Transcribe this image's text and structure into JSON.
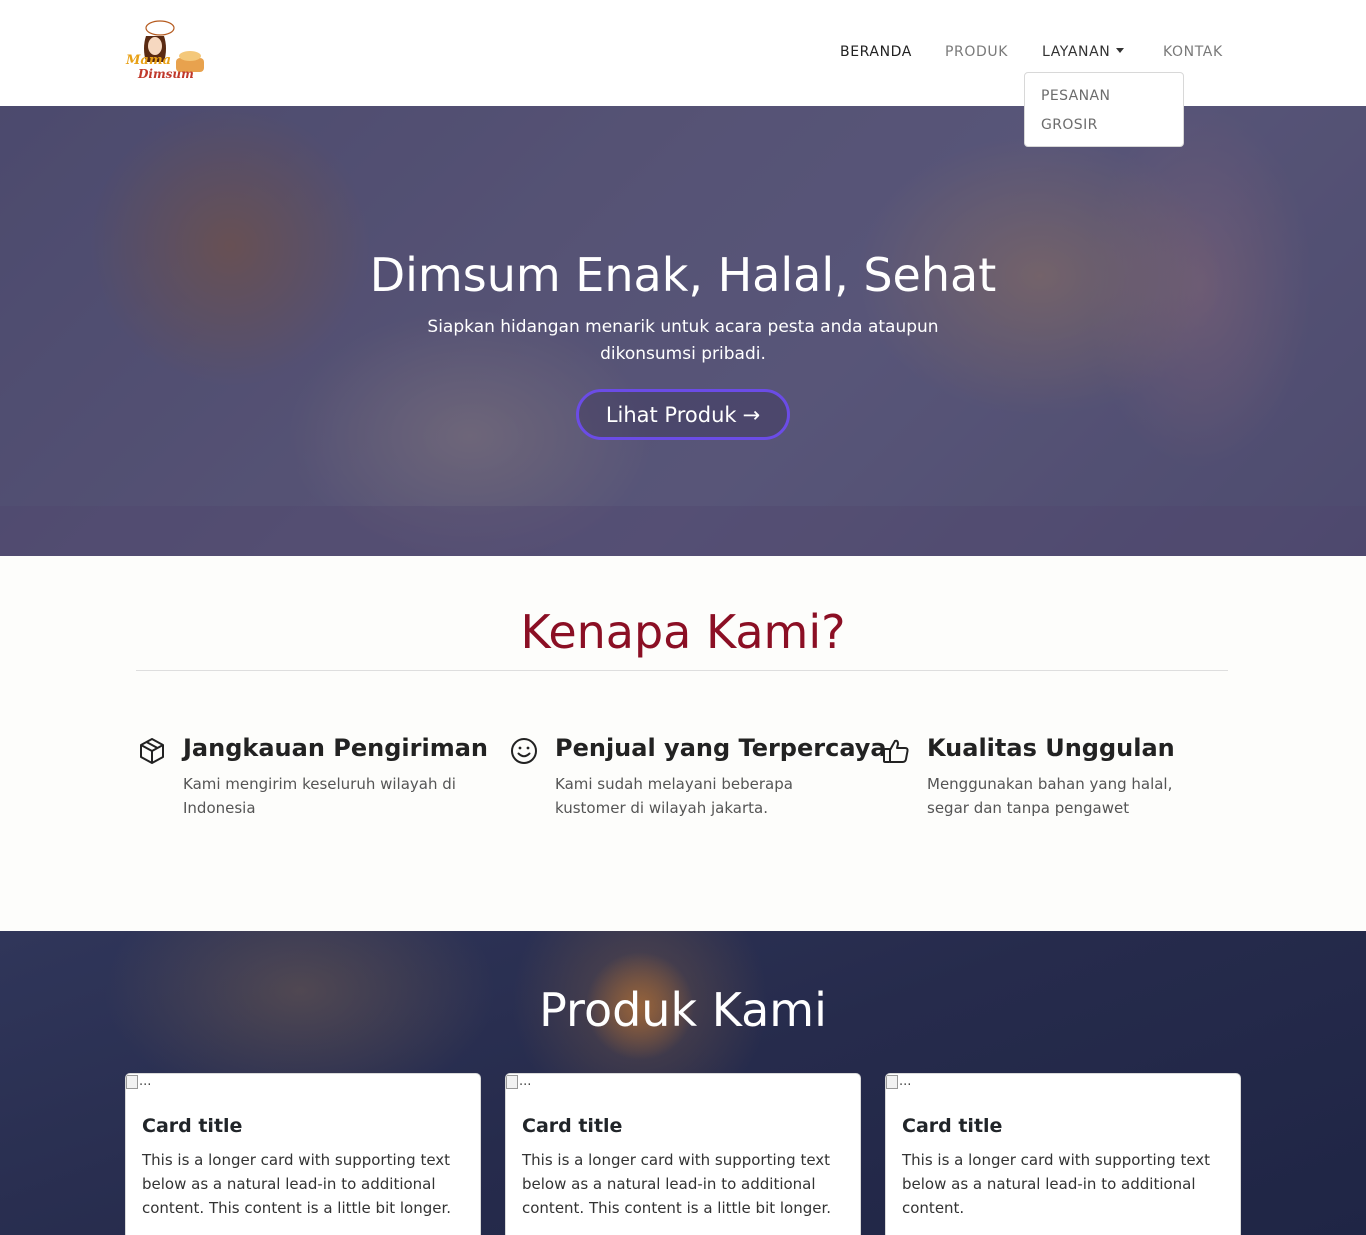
{
  "brand": {
    "logo_text_1": "Mama",
    "logo_text_2": "Dimsum"
  },
  "nav": {
    "items": [
      {
        "label": "BERANDA"
      },
      {
        "label": "PRODUK"
      },
      {
        "label": "LAYANAN"
      },
      {
        "label": "KONTAK"
      }
    ],
    "dropdown": [
      {
        "label": "PESANAN"
      },
      {
        "label": "GROSIR"
      }
    ]
  },
  "hero": {
    "title": "Dimsum Enak, Halal, Sehat",
    "subtitle": "Siapkan hidangan menarik untuk acara pesta anda ataupun dikonsumsi pribadi.",
    "button_label": "Lihat Produk",
    "button_arrow": "→"
  },
  "why": {
    "title": "Kenapa Kami?",
    "features": [
      {
        "icon": "box-icon",
        "title": "Jangkauan Pengiriman",
        "text": "Kami mengirim keseluruh wilayah di Indonesia"
      },
      {
        "icon": "smile-icon",
        "title": "Penjual yang Terpercaya",
        "text": "Kami sudah melayani beberapa kustomer di wilayah jakarta."
      },
      {
        "icon": "thumbs-up-icon",
        "title": "Kualitas Unggulan",
        "text": "Menggunakan bahan yang halal, segar dan tanpa pengawet"
      }
    ]
  },
  "products": {
    "title": "Produk Kami",
    "cards": [
      {
        "img_alt": "...",
        "title": "Card title",
        "text": "This is a longer card with supporting text below as a natural lead-in to additional content. This content is a little bit longer."
      },
      {
        "img_alt": "...",
        "title": "Card title",
        "text": "This is a longer card with supporting text below as a natural lead-in to additional content. This content is a little bit longer."
      },
      {
        "img_alt": "...",
        "title": "Card title",
        "text": "This is a longer card with supporting text below as a natural lead-in to additional content."
      }
    ]
  },
  "colors": {
    "accent_red": "#8b0f24",
    "button_border": "#6b4ce6",
    "products_bg": "#262b4c"
  }
}
